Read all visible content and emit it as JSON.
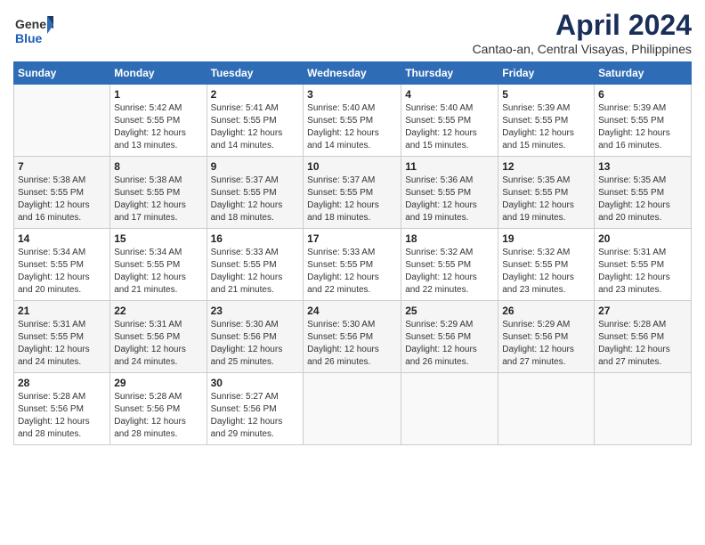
{
  "header": {
    "logo_general": "General",
    "logo_blue": "Blue",
    "month_title": "April 2024",
    "subtitle": "Cantao-an, Central Visayas, Philippines"
  },
  "calendar": {
    "days_of_week": [
      "Sunday",
      "Monday",
      "Tuesday",
      "Wednesday",
      "Thursday",
      "Friday",
      "Saturday"
    ],
    "weeks": [
      [
        {
          "day": "",
          "detail": ""
        },
        {
          "day": "1",
          "detail": "Sunrise: 5:42 AM\nSunset: 5:55 PM\nDaylight: 12 hours\nand 13 minutes."
        },
        {
          "day": "2",
          "detail": "Sunrise: 5:41 AM\nSunset: 5:55 PM\nDaylight: 12 hours\nand 14 minutes."
        },
        {
          "day": "3",
          "detail": "Sunrise: 5:40 AM\nSunset: 5:55 PM\nDaylight: 12 hours\nand 14 minutes."
        },
        {
          "day": "4",
          "detail": "Sunrise: 5:40 AM\nSunset: 5:55 PM\nDaylight: 12 hours\nand 15 minutes."
        },
        {
          "day": "5",
          "detail": "Sunrise: 5:39 AM\nSunset: 5:55 PM\nDaylight: 12 hours\nand 15 minutes."
        },
        {
          "day": "6",
          "detail": "Sunrise: 5:39 AM\nSunset: 5:55 PM\nDaylight: 12 hours\nand 16 minutes."
        }
      ],
      [
        {
          "day": "7",
          "detail": "Sunrise: 5:38 AM\nSunset: 5:55 PM\nDaylight: 12 hours\nand 16 minutes."
        },
        {
          "day": "8",
          "detail": "Sunrise: 5:38 AM\nSunset: 5:55 PM\nDaylight: 12 hours\nand 17 minutes."
        },
        {
          "day": "9",
          "detail": "Sunrise: 5:37 AM\nSunset: 5:55 PM\nDaylight: 12 hours\nand 18 minutes."
        },
        {
          "day": "10",
          "detail": "Sunrise: 5:37 AM\nSunset: 5:55 PM\nDaylight: 12 hours\nand 18 minutes."
        },
        {
          "day": "11",
          "detail": "Sunrise: 5:36 AM\nSunset: 5:55 PM\nDaylight: 12 hours\nand 19 minutes."
        },
        {
          "day": "12",
          "detail": "Sunrise: 5:35 AM\nSunset: 5:55 PM\nDaylight: 12 hours\nand 19 minutes."
        },
        {
          "day": "13",
          "detail": "Sunrise: 5:35 AM\nSunset: 5:55 PM\nDaylight: 12 hours\nand 20 minutes."
        }
      ],
      [
        {
          "day": "14",
          "detail": "Sunrise: 5:34 AM\nSunset: 5:55 PM\nDaylight: 12 hours\nand 20 minutes."
        },
        {
          "day": "15",
          "detail": "Sunrise: 5:34 AM\nSunset: 5:55 PM\nDaylight: 12 hours\nand 21 minutes."
        },
        {
          "day": "16",
          "detail": "Sunrise: 5:33 AM\nSunset: 5:55 PM\nDaylight: 12 hours\nand 21 minutes."
        },
        {
          "day": "17",
          "detail": "Sunrise: 5:33 AM\nSunset: 5:55 PM\nDaylight: 12 hours\nand 22 minutes."
        },
        {
          "day": "18",
          "detail": "Sunrise: 5:32 AM\nSunset: 5:55 PM\nDaylight: 12 hours\nand 22 minutes."
        },
        {
          "day": "19",
          "detail": "Sunrise: 5:32 AM\nSunset: 5:55 PM\nDaylight: 12 hours\nand 23 minutes."
        },
        {
          "day": "20",
          "detail": "Sunrise: 5:31 AM\nSunset: 5:55 PM\nDaylight: 12 hours\nand 23 minutes."
        }
      ],
      [
        {
          "day": "21",
          "detail": "Sunrise: 5:31 AM\nSunset: 5:55 PM\nDaylight: 12 hours\nand 24 minutes."
        },
        {
          "day": "22",
          "detail": "Sunrise: 5:31 AM\nSunset: 5:56 PM\nDaylight: 12 hours\nand 24 minutes."
        },
        {
          "day": "23",
          "detail": "Sunrise: 5:30 AM\nSunset: 5:56 PM\nDaylight: 12 hours\nand 25 minutes."
        },
        {
          "day": "24",
          "detail": "Sunrise: 5:30 AM\nSunset: 5:56 PM\nDaylight: 12 hours\nand 26 minutes."
        },
        {
          "day": "25",
          "detail": "Sunrise: 5:29 AM\nSunset: 5:56 PM\nDaylight: 12 hours\nand 26 minutes."
        },
        {
          "day": "26",
          "detail": "Sunrise: 5:29 AM\nSunset: 5:56 PM\nDaylight: 12 hours\nand 27 minutes."
        },
        {
          "day": "27",
          "detail": "Sunrise: 5:28 AM\nSunset: 5:56 PM\nDaylight: 12 hours\nand 27 minutes."
        }
      ],
      [
        {
          "day": "28",
          "detail": "Sunrise: 5:28 AM\nSunset: 5:56 PM\nDaylight: 12 hours\nand 28 minutes."
        },
        {
          "day": "29",
          "detail": "Sunrise: 5:28 AM\nSunset: 5:56 PM\nDaylight: 12 hours\nand 28 minutes."
        },
        {
          "day": "30",
          "detail": "Sunrise: 5:27 AM\nSunset: 5:56 PM\nDaylight: 12 hours\nand 29 minutes."
        },
        {
          "day": "",
          "detail": ""
        },
        {
          "day": "",
          "detail": ""
        },
        {
          "day": "",
          "detail": ""
        },
        {
          "day": "",
          "detail": ""
        }
      ]
    ]
  }
}
